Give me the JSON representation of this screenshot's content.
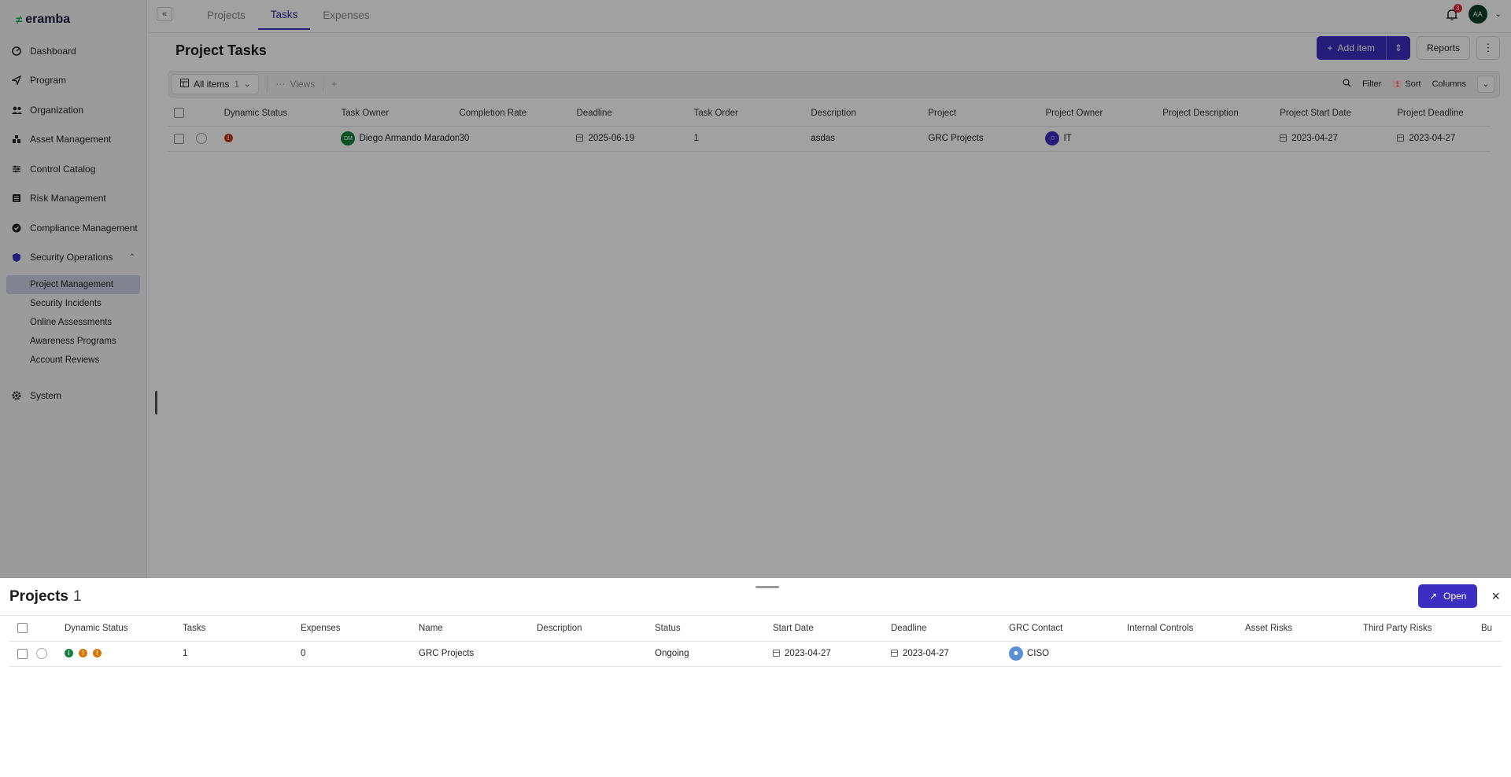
{
  "app": {
    "logo": "eramba",
    "nav": [
      {
        "label": "Dashboard",
        "icon": "dashboard-icon"
      },
      {
        "label": "Program",
        "icon": "program-icon"
      },
      {
        "label": "Organization",
        "icon": "organization-icon"
      },
      {
        "label": "Asset Management",
        "icon": "asset-icon"
      },
      {
        "label": "Control Catalog",
        "icon": "control-icon"
      },
      {
        "label": "Risk Management",
        "icon": "risk-icon"
      },
      {
        "label": "Compliance Management",
        "icon": "compliance-icon"
      },
      {
        "label": "Security Operations",
        "icon": "shield-icon"
      }
    ],
    "sub_nav": [
      "Project Management",
      "Security Incidents",
      "Online Assessments",
      "Awareness Programs",
      "Account Reviews"
    ],
    "system": "System"
  },
  "topbar": {
    "collapse": "«",
    "tabs": [
      "Projects",
      "Tasks",
      "Expenses"
    ],
    "notifications": "3",
    "avatar": "AA"
  },
  "page": {
    "title": "Project Tasks",
    "add_item": "Add item",
    "reports": "Reports"
  },
  "filterbar": {
    "all_items": "All items",
    "all_items_count": "1",
    "views": "Views",
    "filter": "Filter",
    "sort_count": "1",
    "sort": "Sort",
    "columns": "Columns"
  },
  "tasks_table": {
    "headers": [
      "Dynamic Status",
      "Task Owner",
      "Completion Rate",
      "Deadline",
      "Task Order",
      "Description",
      "Project",
      "Project Owner",
      "Project Description",
      "Project Start Date",
      "Project Deadline"
    ],
    "row": {
      "owner_initials": "DM",
      "owner": "Diego Armando Maradona",
      "completion": "30",
      "deadline": "2025-06-19",
      "order": "1",
      "description": "asdas",
      "project": "GRC Projects",
      "project_owner": "IT",
      "project_description": "",
      "start": "2023-04-27",
      "project_deadline": "2023-04-27"
    }
  },
  "drawer": {
    "title": "Projects",
    "count": "1",
    "open": "Open",
    "close": "×",
    "headers": [
      "Dynamic Status",
      "Tasks",
      "Expenses",
      "Name",
      "Description",
      "Status",
      "Start Date",
      "Deadline",
      "GRC Contact",
      "Internal Controls",
      "Asset Risks",
      "Third Party Risks",
      "Bu"
    ],
    "row": {
      "tasks": "1",
      "expenses": "0",
      "name": "GRC Projects",
      "description": "",
      "status": "Ongoing",
      "start": "2023-04-27",
      "deadline": "2023-04-27",
      "contact": "CISO"
    }
  },
  "colors": {
    "accent": "#3b2ec0",
    "status_red": "#c0391b",
    "status_orange": "#d97706",
    "status_green": "#15803d"
  }
}
